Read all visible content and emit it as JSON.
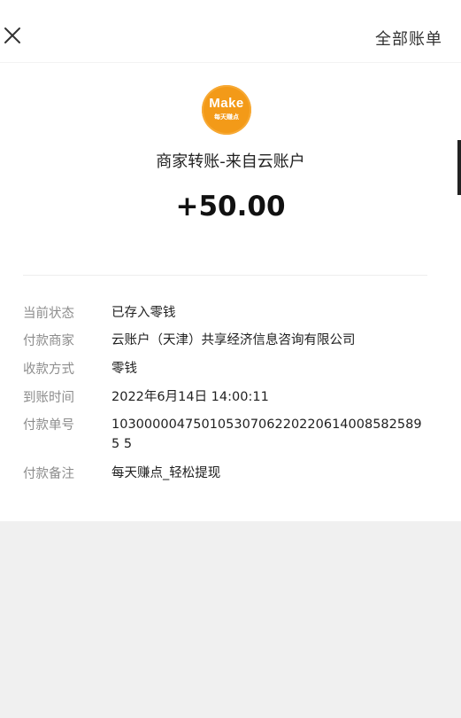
{
  "header": {
    "all_bills_label": "全部账单"
  },
  "logo": {
    "main_text": "Make",
    "sub_text": "每天赚点"
  },
  "transaction": {
    "title": "商家转账-来自云账户",
    "amount": "+50.00"
  },
  "details": [
    {
      "label": "当前状态",
      "value": "已存入零钱"
    },
    {
      "label": "付款商家",
      "value": "云账户（天津）共享经济信息咨询有限公司"
    },
    {
      "label": "收款方式",
      "value": "零钱"
    },
    {
      "label": "到账时间",
      "value": "2022年6月14日 14:00:11"
    },
    {
      "label": "付款单号",
      "value": "103000004750105307062202206140085825895 5"
    },
    {
      "label": "付款备注",
      "value": "每天赚点_轻松提现"
    }
  ],
  "colors": {
    "logo_orange": "#f39a18",
    "background_gray": "#f0f0f0",
    "label_gray": "#8d8d8d"
  }
}
